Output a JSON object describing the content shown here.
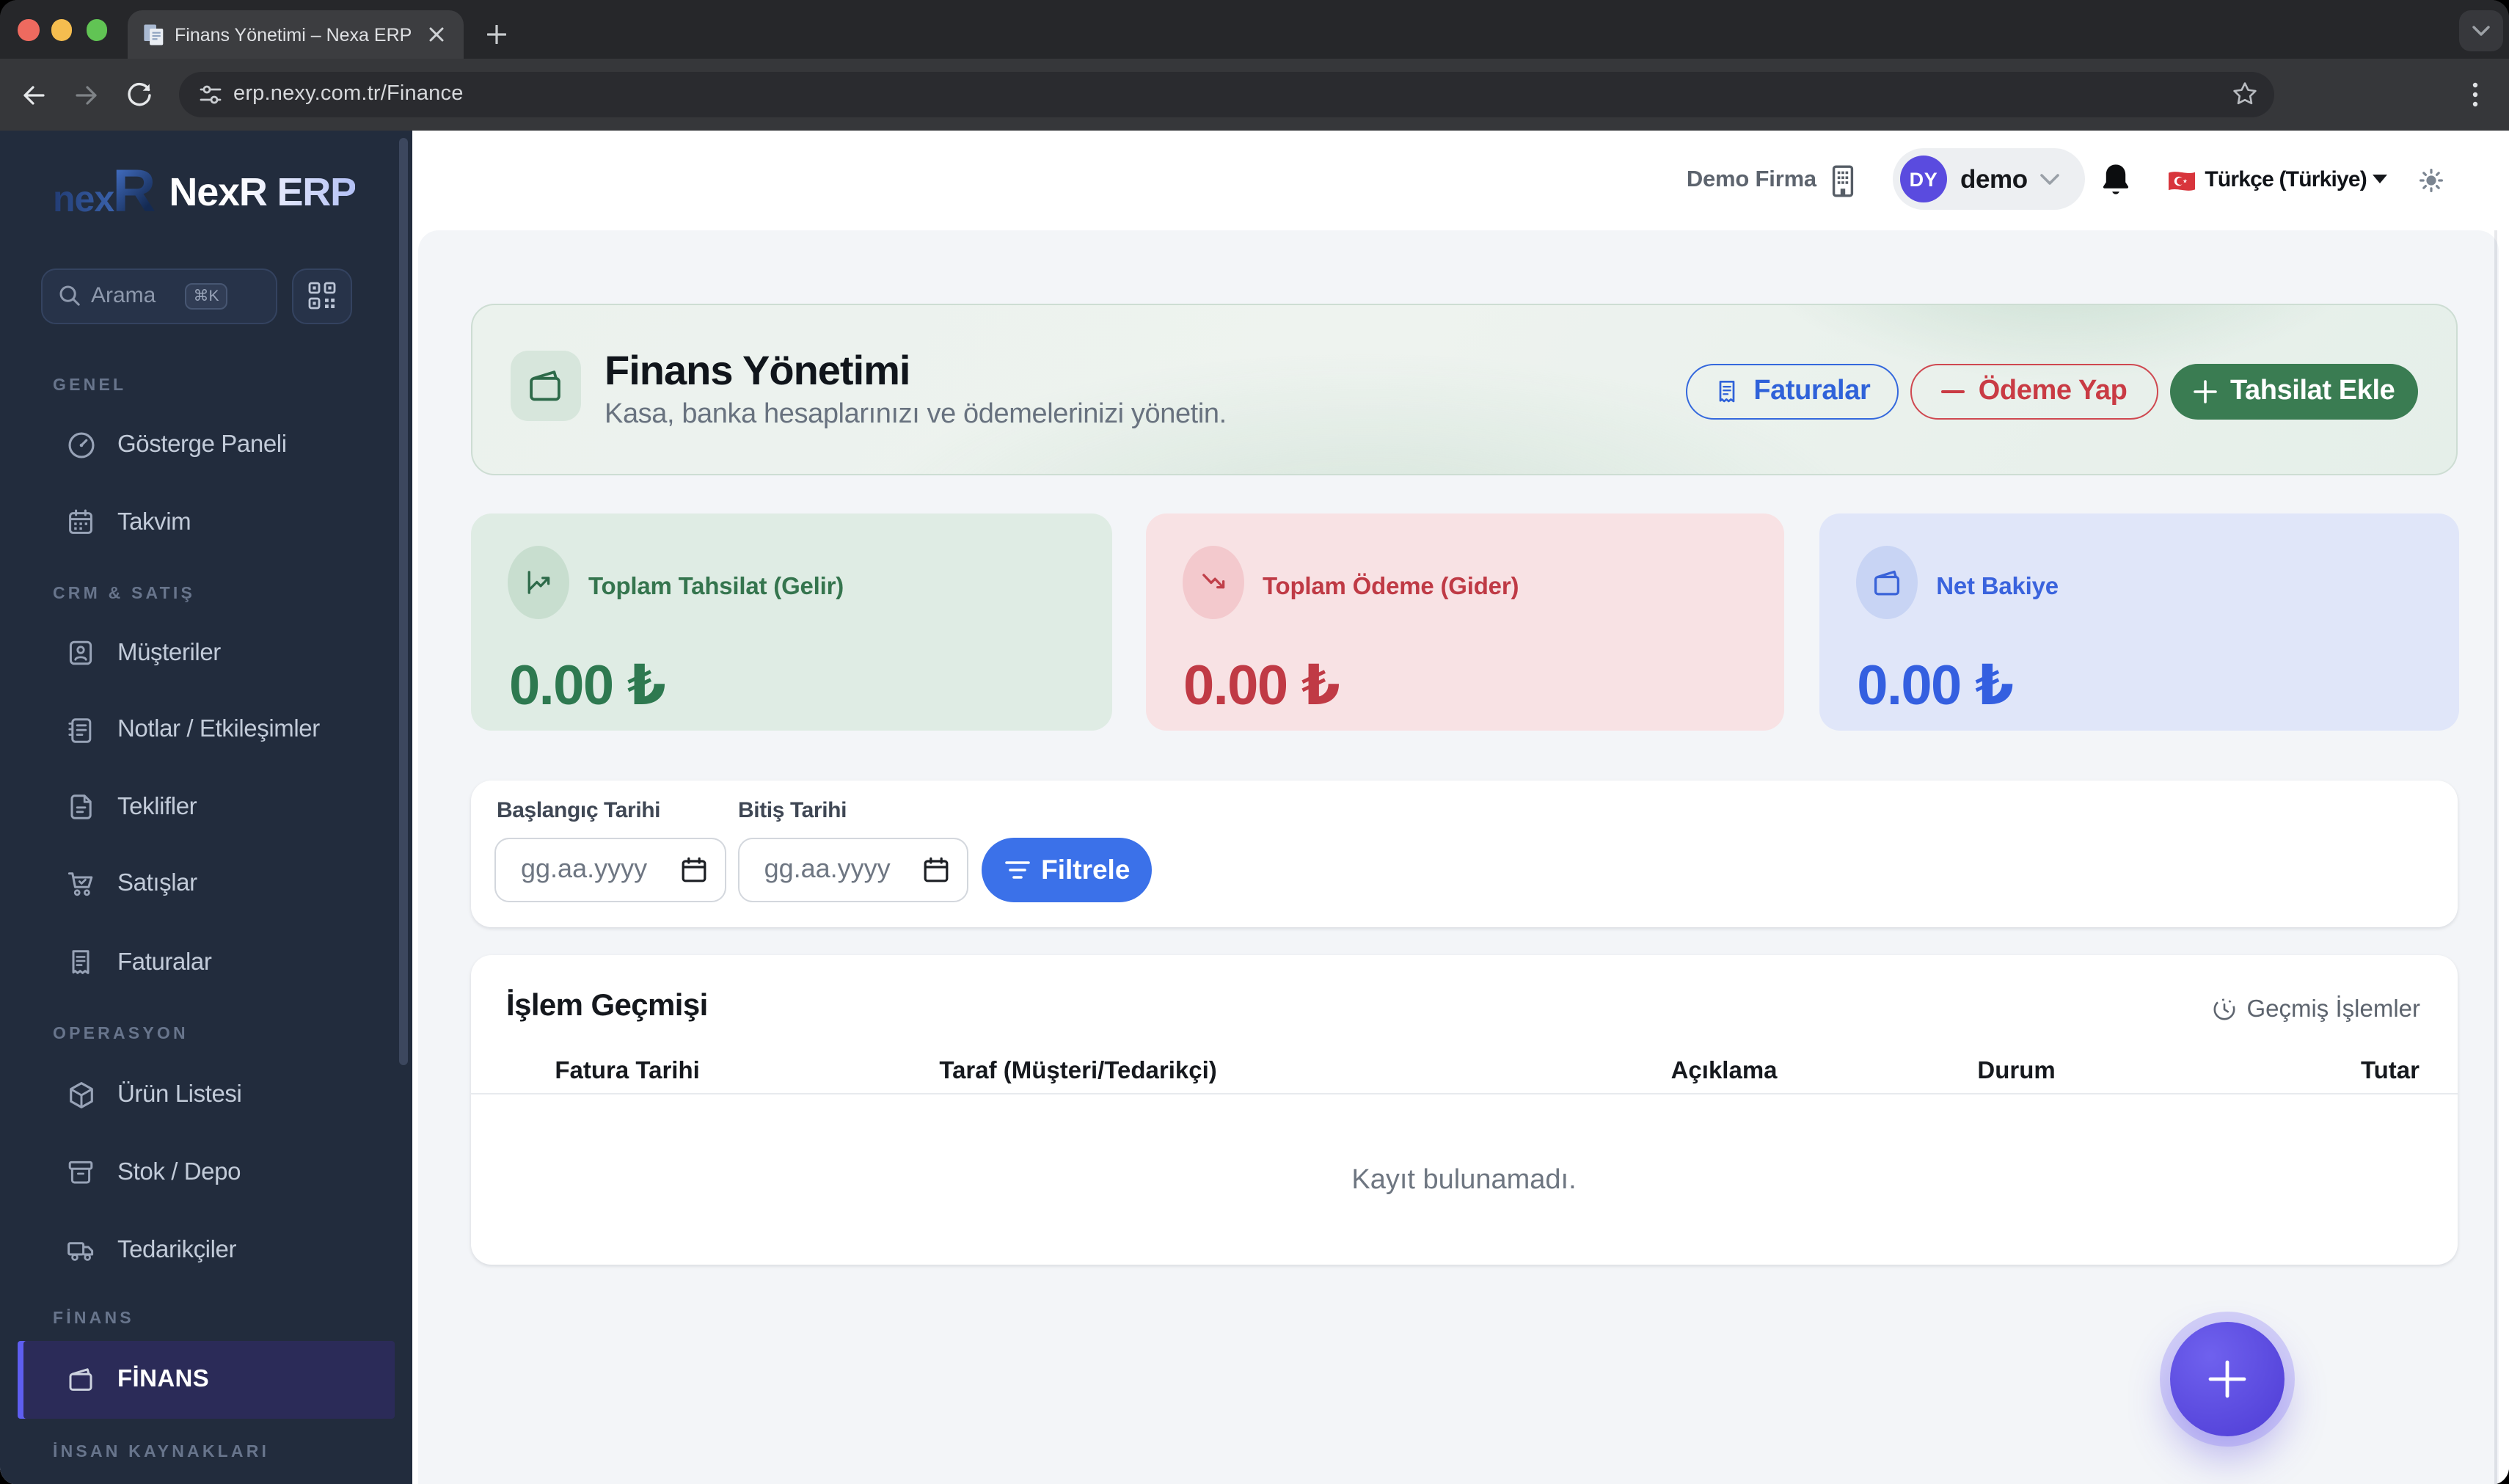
{
  "browser": {
    "tab_title": "Finans Yönetimi – Nexa ERP",
    "url": "erp.nexy.com.tr/Finance"
  },
  "sidebar": {
    "logo_prefix": "nex",
    "logo_r": "R",
    "logo_text": "NexR ERP",
    "search": {
      "placeholder": "Arama",
      "shortcut": "⌘K"
    },
    "sections": [
      {
        "label": "GENEL",
        "items": [
          {
            "label": "Gösterge Paneli"
          },
          {
            "label": "Takvim"
          }
        ]
      },
      {
        "label": "CRM & SATIŞ",
        "items": [
          {
            "label": "Müşteriler"
          },
          {
            "label": "Notlar / Etkileşimler"
          },
          {
            "label": "Teklifler"
          },
          {
            "label": "Satışlar"
          },
          {
            "label": "Faturalar"
          }
        ]
      },
      {
        "label": "OPERASYON",
        "items": [
          {
            "label": "Ürün Listesi"
          },
          {
            "label": "Stok / Depo"
          },
          {
            "label": "Tedarikçiler"
          }
        ]
      },
      {
        "label": "FİNANS",
        "items": [
          {
            "label": "FİNANS"
          }
        ]
      },
      {
        "label": "İNSAN KAYNAKLARI",
        "items": []
      }
    ]
  },
  "header": {
    "company": "Demo Firma",
    "avatar_initials": "DY",
    "username": "demo",
    "language": "Türkçe (Türkiye)"
  },
  "hero": {
    "title": "Finans Yönetimi",
    "subtitle": "Kasa, banka hesaplarınızı ve ödemelerinizi yönetin.",
    "buttons": {
      "invoices": "Faturalar",
      "pay": "Ödeme Yap",
      "collect": "Tahsilat Ekle"
    }
  },
  "stats": [
    {
      "label": "Toplam Tahsilat (Gelir)",
      "value": "0.00 ₺",
      "accent": "#2e7950"
    },
    {
      "label": "Toplam Ödeme (Gider)",
      "value": "0.00 ₺",
      "accent": "#c03a45"
    },
    {
      "label": "Net Bakiye",
      "value": "0.00 ₺",
      "accent": "#345fe0"
    }
  ],
  "filters": {
    "start_label": "Başlangıç Tarihi",
    "end_label": "Bitiş Tarihi",
    "date_placeholder": "gg.aa.yyyy",
    "apply_label": "Filtrele"
  },
  "table": {
    "title": "İşlem Geçmişi",
    "history_link": "Geçmiş İşlemler",
    "columns": [
      "Fatura Tarihi",
      "Taraf (Müşteri/Tedarikçi)",
      "Açıklama",
      "Durum",
      "Tutar"
    ],
    "empty": "Kayıt bulunamadı."
  }
}
